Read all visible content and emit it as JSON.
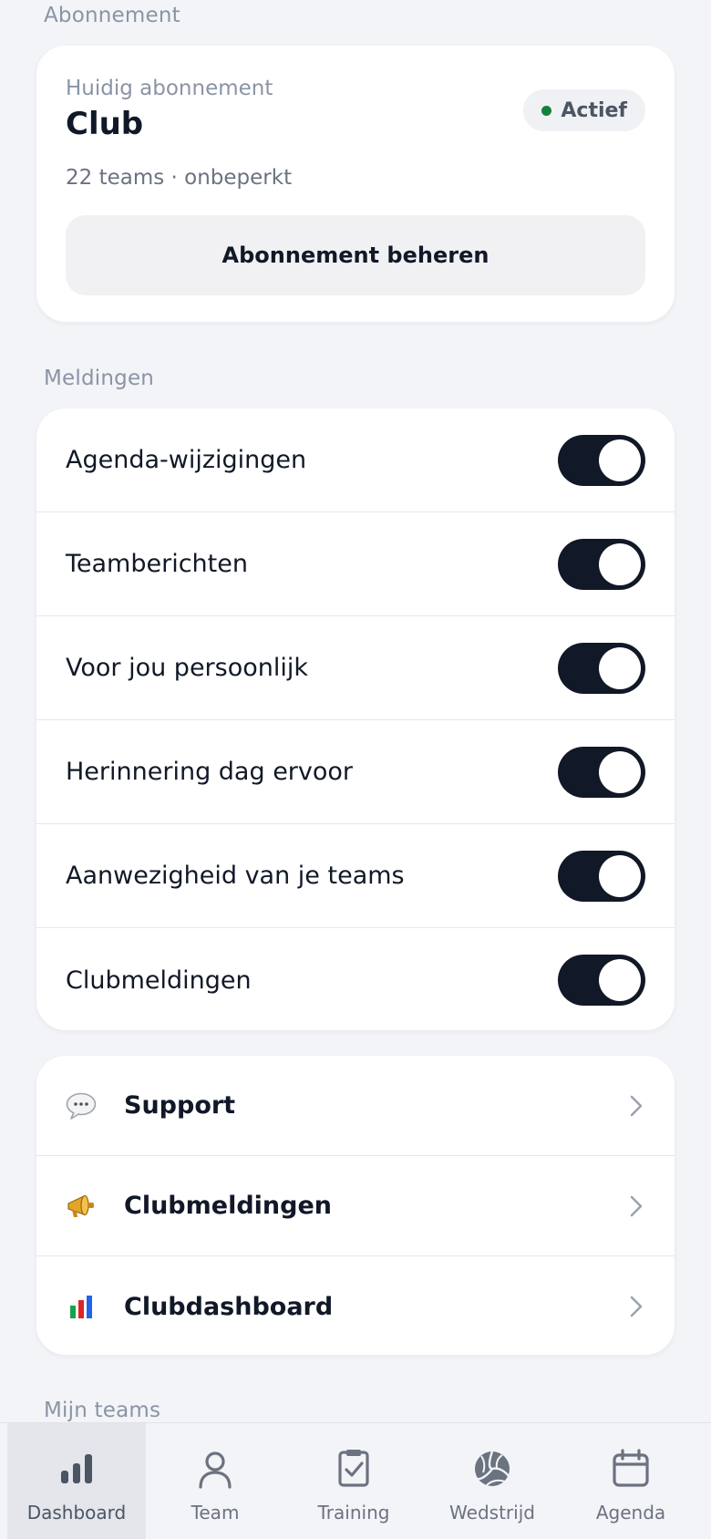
{
  "sections": {
    "subscription": "Abonnement",
    "notifications": "Meldingen",
    "my_teams": "Mijn teams"
  },
  "subscription": {
    "kicker": "Huidig abonnement",
    "plan": "Club",
    "meta": "22 teams · onbeperkt",
    "status": "Actief",
    "status_color": "#15803d",
    "manage_label": "Abonnement beheren"
  },
  "notifications": [
    {
      "label": "Agenda-wijzigingen",
      "enabled": true
    },
    {
      "label": "Teamberichten",
      "enabled": true
    },
    {
      "label": "Voor jou persoonlijk",
      "enabled": true
    },
    {
      "label": "Herinnering dag ervoor",
      "enabled": true
    },
    {
      "label": "Aanwezigheid van je teams",
      "enabled": true
    },
    {
      "label": "Clubmeldingen",
      "enabled": true
    }
  ],
  "links": [
    {
      "label": "Support",
      "icon": "speech-bubble-icon"
    },
    {
      "label": "Clubmeldingen",
      "icon": "megaphone-icon"
    },
    {
      "label": "Clubdashboard",
      "icon": "bar-chart-icon"
    }
  ],
  "nav": [
    {
      "label": "Dashboard",
      "icon": "bar-chart-icon",
      "active": true
    },
    {
      "label": "Team",
      "icon": "person-icon",
      "active": false
    },
    {
      "label": "Training",
      "icon": "clipboard-check-icon",
      "active": false
    },
    {
      "label": "Wedstrijd",
      "icon": "volleyball-icon",
      "active": false
    },
    {
      "label": "Agenda",
      "icon": "calendar-icon",
      "active": false
    }
  ],
  "colors": {
    "toggle_on": "#111827",
    "background": "#f3f4f7"
  }
}
